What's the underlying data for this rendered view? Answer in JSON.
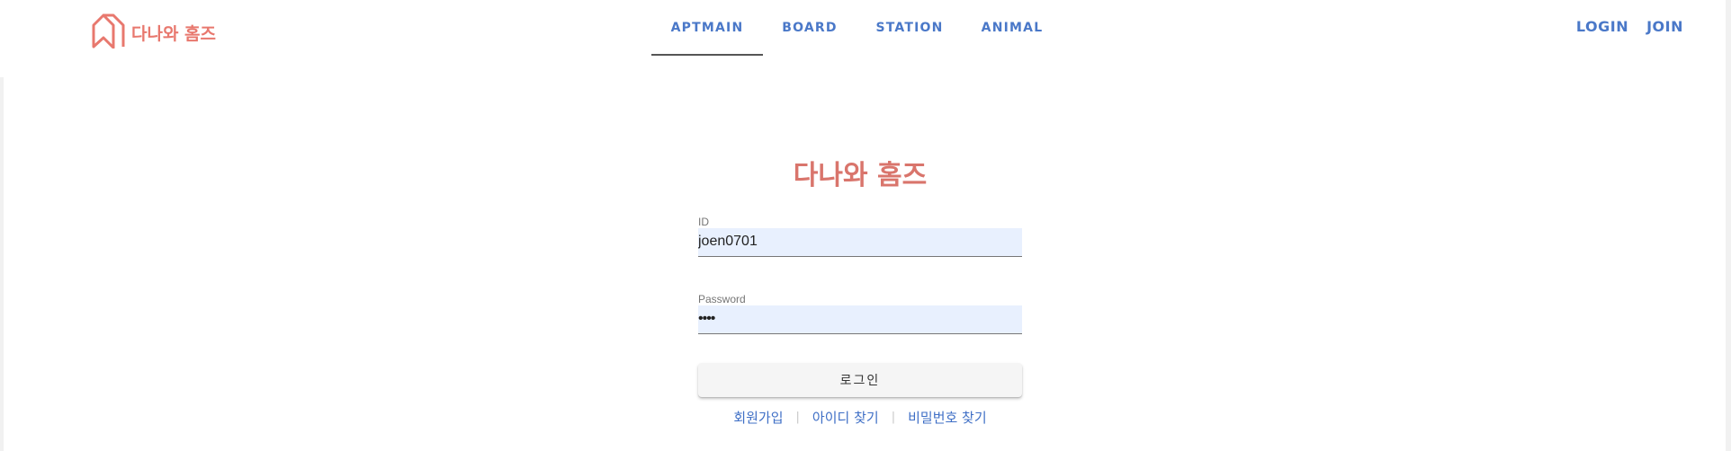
{
  "brand": {
    "name": "다나와 홈즈",
    "color": "#e8786e",
    "icon": "house-outline-icon"
  },
  "nav": {
    "tabs": [
      {
        "label": "APTMAIN",
        "active": true
      },
      {
        "label": "BOARD",
        "active": false
      },
      {
        "label": "STATION",
        "active": false
      },
      {
        "label": "ANIMAL",
        "active": false
      }
    ]
  },
  "auth": {
    "login_label": "LOGIN",
    "join_label": "JOIN"
  },
  "login_form": {
    "title": "다나와 홈즈",
    "id_label": "ID",
    "id_value": "joen0701",
    "password_label": "Password",
    "password_value": "••••",
    "submit_label": "로그인",
    "links": {
      "signup": "회원가입",
      "find_id": "아이디 찾기",
      "find_password": "비밀번호 찾기",
      "separator": "|"
    }
  },
  "colors": {
    "accent": "#4a78c8",
    "title": "#d9756c",
    "input_bg": "#e8f0fe"
  }
}
